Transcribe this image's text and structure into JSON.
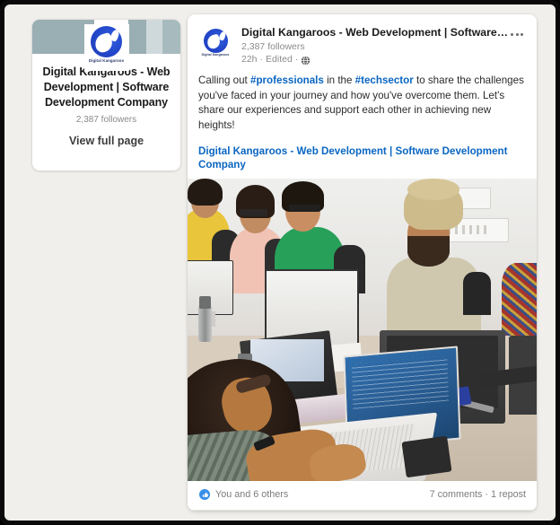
{
  "company_card": {
    "name": "Digital Kangaroos - Web Development | Software Development Company",
    "followers": "2,387 followers",
    "cta": "View full page",
    "logo_wordmark": "Digital Kangaroos"
  },
  "post": {
    "author": "Digital Kangaroos - Web Development | Software Development ...",
    "followers": "2,387 followers",
    "time": "22h",
    "edited": "Edited",
    "separator": "·",
    "visibility_icon": "globe-icon",
    "more_icon": "ellipsis-icon",
    "text_parts": {
      "p1": "Calling out ",
      "tag1": "#professionals",
      "p2": " in the ",
      "tag2": "#techsector",
      "p3": " to share the challenges you've faced in your journey and how you've overcome them. Let's share our experiences and support each other in achieving new heights!"
    },
    "link_text": "Digital Kangaroos - Web Development | Software Development Company",
    "image_alt": "Office workspace with team members working at desktop computers and laptops",
    "footer": {
      "reactions_text": "You and 6 others",
      "reaction_icon": "thumbs-up-icon",
      "stats_text": "7 comments · 1 repost"
    }
  },
  "colors": {
    "linkedin_blue": "#0a66c2",
    "reaction_blue": "#378fe9",
    "banner_teal": "#9aafb3",
    "page_background": "#f1efeb",
    "card_background": "#ffffff"
  }
}
